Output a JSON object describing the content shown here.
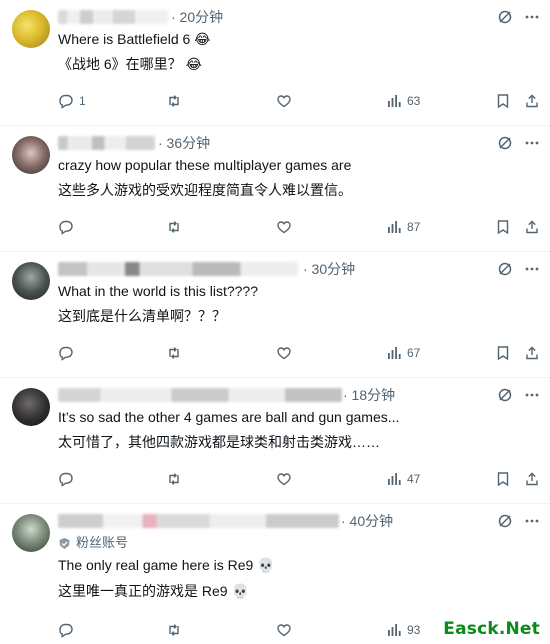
{
  "posts": [
    {
      "time": "· 20分钟",
      "lines": [
        "Where is Battlefield 6 😂",
        "《战地 6》在哪里？ 😂"
      ],
      "reply_count": "1",
      "repost_count": "",
      "like_count": "",
      "view_count": "63"
    },
    {
      "time": "· 36分钟",
      "lines": [
        "crazy how popular these multiplayer games are",
        "这些多人游戏的受欢迎程度简直令人难以置信。"
      ],
      "reply_count": "",
      "repost_count": "",
      "like_count": "",
      "view_count": "87"
    },
    {
      "time": "· 30分钟",
      "lines": [
        "What in the world is this list????",
        "这到底是什么清单啊？？？"
      ],
      "reply_count": "",
      "repost_count": "",
      "like_count": "",
      "view_count": "67"
    },
    {
      "time": "· 18分钟",
      "lines": [
        "It’s so sad the other 4 games are ball and gun games...",
        "太可惜了，其他四款游戏都是球类和射击类游戏……"
      ],
      "reply_count": "",
      "repost_count": "",
      "like_count": "",
      "view_count": "47"
    },
    {
      "time": "· 40分钟",
      "badge": "粉丝账号",
      "lines": [
        "The only real game here is Re9 💀",
        "这里唯一真正的游戏是 Re9 💀"
      ],
      "reply_count": "",
      "repost_count": "",
      "like_count": "",
      "view_count": "93"
    }
  ],
  "watermark": "Easck.Net",
  "icons": {
    "reply": "reply-icon",
    "repost": "repost-icon",
    "like": "like-icon",
    "views": "views-icon",
    "bookmark": "bookmark-icon",
    "share": "share-icon",
    "grok": "grok-icon",
    "more": "more-icon"
  },
  "colors": {
    "icon": "#536471",
    "text": "#0f1419",
    "divider": "#eff3f4",
    "watermark": "#0c8b1b"
  }
}
